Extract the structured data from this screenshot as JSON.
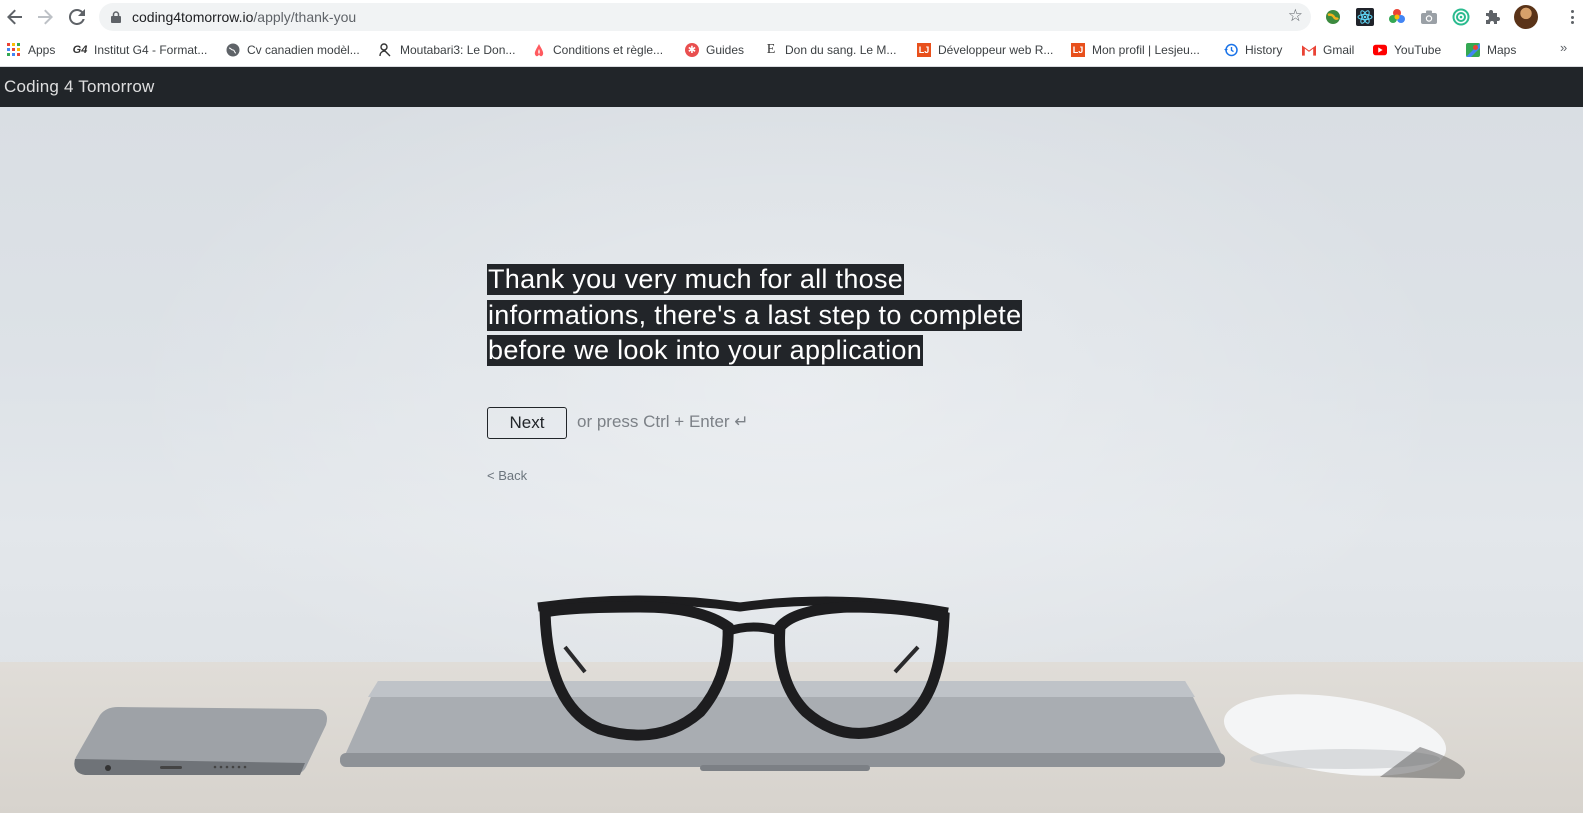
{
  "browser": {
    "url_host": "coding4tomorrow.io",
    "url_path": "/apply/thank-you",
    "bookmarks": [
      {
        "label": "Apps",
        "icon": "apps-grid-icon"
      },
      {
        "label": "Institut G4 - Format...",
        "icon": "g4-logo-icon"
      },
      {
        "label": "Cv canadien modèl...",
        "icon": "globe-icon"
      },
      {
        "label": "Moutabari3: Le Don...",
        "icon": "person-icon"
      },
      {
        "label": "Conditions et règle...",
        "icon": "airbnb-icon"
      },
      {
        "label": "Guides",
        "icon": "guides-icon"
      },
      {
        "label": "Don du sang. Le M...",
        "icon": "blood-donation-icon"
      },
      {
        "label": "Développeur web R...",
        "icon": "lesjeudis-icon"
      },
      {
        "label": "Mon profil | Lesjeu...",
        "icon": "lesjeudis-icon"
      },
      {
        "label": "History",
        "icon": "history-icon"
      },
      {
        "label": "Gmail",
        "icon": "gmail-icon"
      },
      {
        "label": "YouTube",
        "icon": "youtube-icon"
      },
      {
        "label": "Maps",
        "icon": "maps-icon"
      }
    ],
    "more_bookmarks": "»"
  },
  "site": {
    "brand": "Coding 4 Tomorrow"
  },
  "form": {
    "question_lines": [
      "Thank you very much for all those",
      "informations, there's a last step to complete",
      "before we look into your application"
    ],
    "next_label": "Next",
    "hint": "or press Ctrl + Enter ↵",
    "back_label": "< Back"
  },
  "colors": {
    "navbar_bg": "#212529",
    "question_bg": "#222529",
    "text_dark": "#212529"
  }
}
